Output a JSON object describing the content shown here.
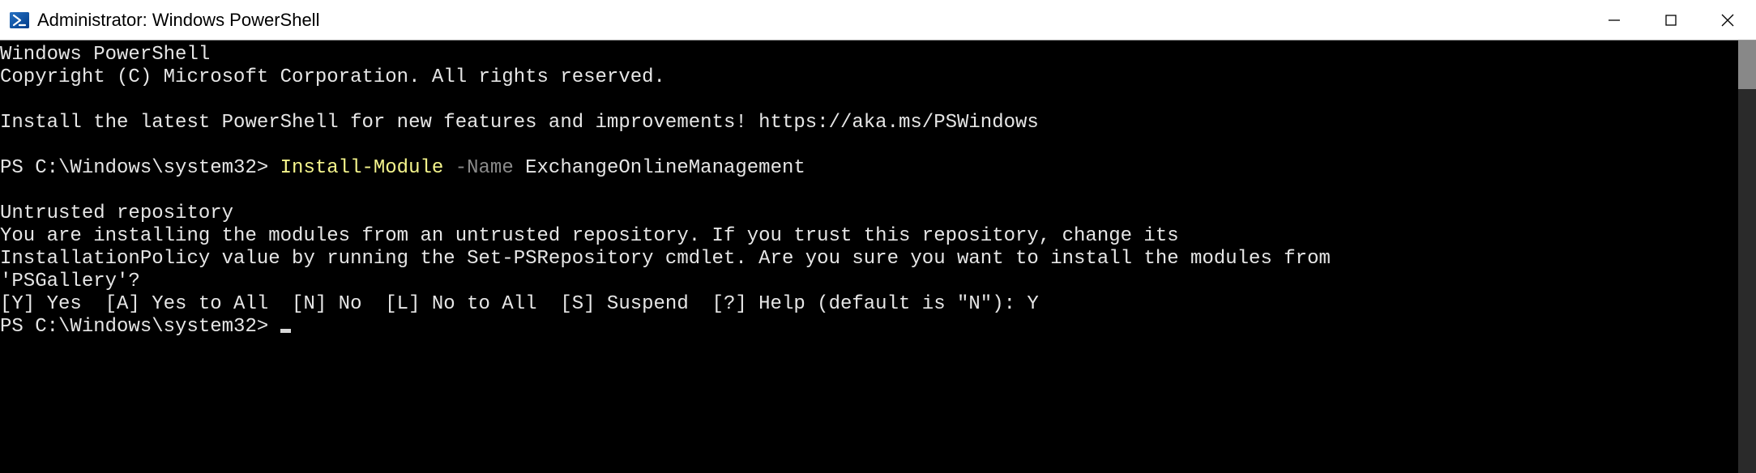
{
  "window": {
    "title": "Administrator: Windows PowerShell"
  },
  "terminal": {
    "line1": "Windows PowerShell",
    "line2": "Copyright (C) Microsoft Corporation. All rights reserved.",
    "blank1": "",
    "line3": "Install the latest PowerShell for new features and improvements! https://aka.ms/PSWindows",
    "blank2": "",
    "prompt1_prefix": "PS C:\\Windows\\system32> ",
    "cmd_part1": "Install-Module ",
    "cmd_part2": "-Name ",
    "cmd_part3": "ExchangeOnlineManagement",
    "blank3": "",
    "warn_title": "Untrusted repository",
    "warn_l1": "You are installing the modules from an untrusted repository. If you trust this repository, change its",
    "warn_l2": "InstallationPolicy value by running the Set-PSRepository cmdlet. Are you sure you want to install the modules from",
    "warn_l3": "'PSGallery'?",
    "options": "[Y] Yes  [A] Yes to All  [N] No  [L] No to All  [S] Suspend  [?] Help (default is \"N\"): Y",
    "prompt2": "PS C:\\Windows\\system32> "
  }
}
